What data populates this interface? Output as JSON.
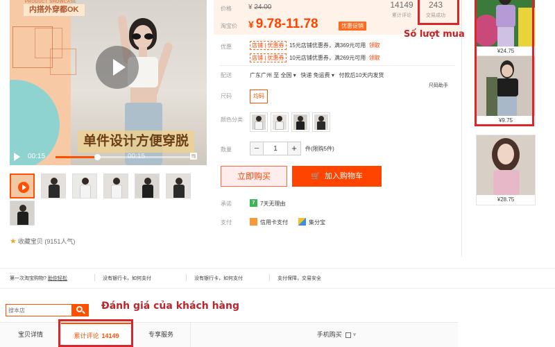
{
  "media": {
    "brand_small": "PRODUCT SHOWCASE",
    "brand_tag": "内搭外穿都OK",
    "slogan": "单件设计方便穿脱",
    "time_current": "00:15",
    "time_dup": "00:15",
    "progress": 0.3
  },
  "favorite": {
    "label": "收藏宝贝",
    "count": "(9151人气)"
  },
  "price": {
    "orig_label": "价格",
    "orig_symbol": "¥",
    "orig_value": "24.00",
    "sale_label": "淘宝价",
    "sale_symbol": "¥",
    "sale_value": "9.78-11.78",
    "promo_badge": "优惠促销"
  },
  "stats": {
    "reviews_count": "14149",
    "reviews_label": "累计评论",
    "sales_count": "243",
    "sales_label": "交易成功"
  },
  "coupons": {
    "label": "优惠",
    "items": [
      {
        "tag": "店铺",
        "tag2": "优惠券",
        "text": "15元店铺优惠券，满369元可用",
        "link": "领取"
      },
      {
        "tag": "店铺",
        "tag2": "优惠券",
        "text": "10元店铺优惠券，满269元可用",
        "link": "领取"
      }
    ]
  },
  "delivery": {
    "label": "配送",
    "from": "广东广州",
    "to_label": "至",
    "to": "全国",
    "fee": "快递 免运费",
    "promise": "付款后10天内发货",
    "assistant": "尺码助手"
  },
  "size": {
    "label": "尺码",
    "option": "均码"
  },
  "color": {
    "label": "颜色分类"
  },
  "quantity": {
    "label": "数量",
    "minus": "−",
    "value": "1",
    "plus": "+",
    "stock": "件(限购5件)"
  },
  "actions": {
    "buy_now": "立即购买",
    "add_cart": "加入购物车",
    "cart_icon": "cart-icon"
  },
  "promise": {
    "label": "承诺",
    "text": "7天无理由",
    "badge": "7"
  },
  "payment": {
    "label": "支付",
    "credit": "信用卡支付",
    "installment": "集分宝"
  },
  "recommend": [
    {
      "price": "¥24.75"
    },
    {
      "price": "¥9.75"
    },
    {
      "price": "¥28.75"
    }
  ],
  "annotations": {
    "sales": "Số lượt mua",
    "reviews": "Đánh giá của khách hàng"
  },
  "help_bar": {
    "items": [
      {
        "text": "第一次淘宝购物?",
        "link": "助你轻松"
      },
      {
        "text": "没有银行卡，如何支付"
      },
      {
        "text": "没有银行卡，如何支付"
      },
      {
        "text": "支付保障，交易安全"
      }
    ]
  },
  "shop_search": {
    "placeholder": "搜本店"
  },
  "tabs": [
    {
      "label": "宝贝详情"
    },
    {
      "label": "累计评论",
      "count": "14149"
    },
    {
      "label": "专享服务"
    },
    {
      "label": "手机购买",
      "qr_icon": "qr-icon"
    }
  ],
  "colors": {
    "accent": "#ff5000",
    "price": "#ff4400",
    "annotation": "#c0242a"
  }
}
